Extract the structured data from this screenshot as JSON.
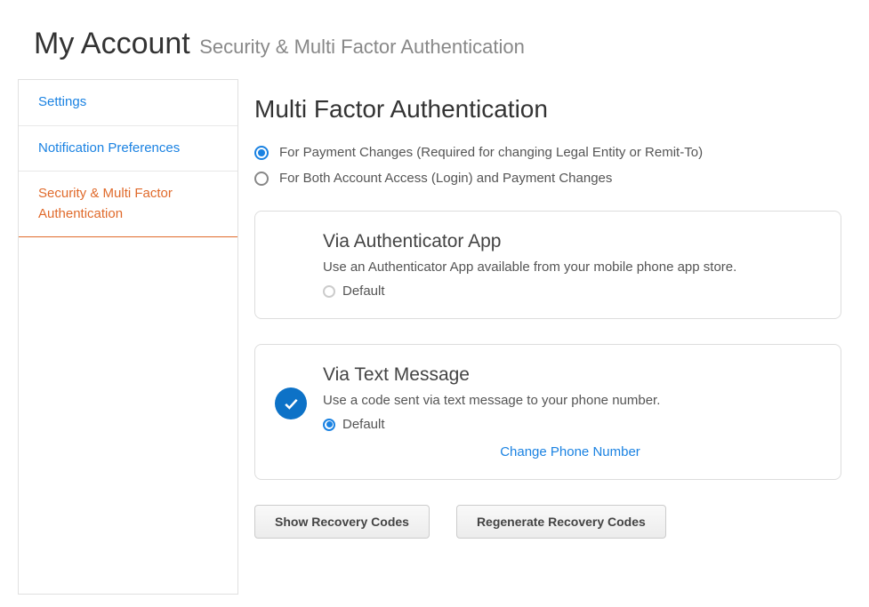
{
  "header": {
    "title": "My Account",
    "subtitle": "Security & Multi Factor Authentication"
  },
  "sidebar": {
    "items": [
      {
        "label": "Settings",
        "active": false
      },
      {
        "label": "Notification Preferences",
        "active": false
      },
      {
        "label": "Security & Multi Factor Authentication",
        "active": true
      }
    ]
  },
  "main": {
    "heading": "Multi Factor Authentication",
    "scopeOptions": [
      {
        "label": "For Payment Changes (Required for changing Legal Entity or Remit-To)",
        "selected": true
      },
      {
        "label": "For Both Account Access (Login) and Payment Changes",
        "selected": false
      }
    ],
    "methods": {
      "authenticatorApp": {
        "title": "Via Authenticator App",
        "description": "Use an Authenticator App available from your mobile phone app store.",
        "defaultLabel": "Default",
        "selected": false,
        "isDefault": false
      },
      "textMessage": {
        "title": "Via Text Message",
        "description": "Use a code sent via text message to your phone number.",
        "defaultLabel": "Default",
        "selected": true,
        "isDefault": true,
        "changeLink": "Change Phone Number"
      }
    },
    "buttons": {
      "showCodes": "Show Recovery Codes",
      "regenerateCodes": "Regenerate Recovery Codes"
    }
  }
}
